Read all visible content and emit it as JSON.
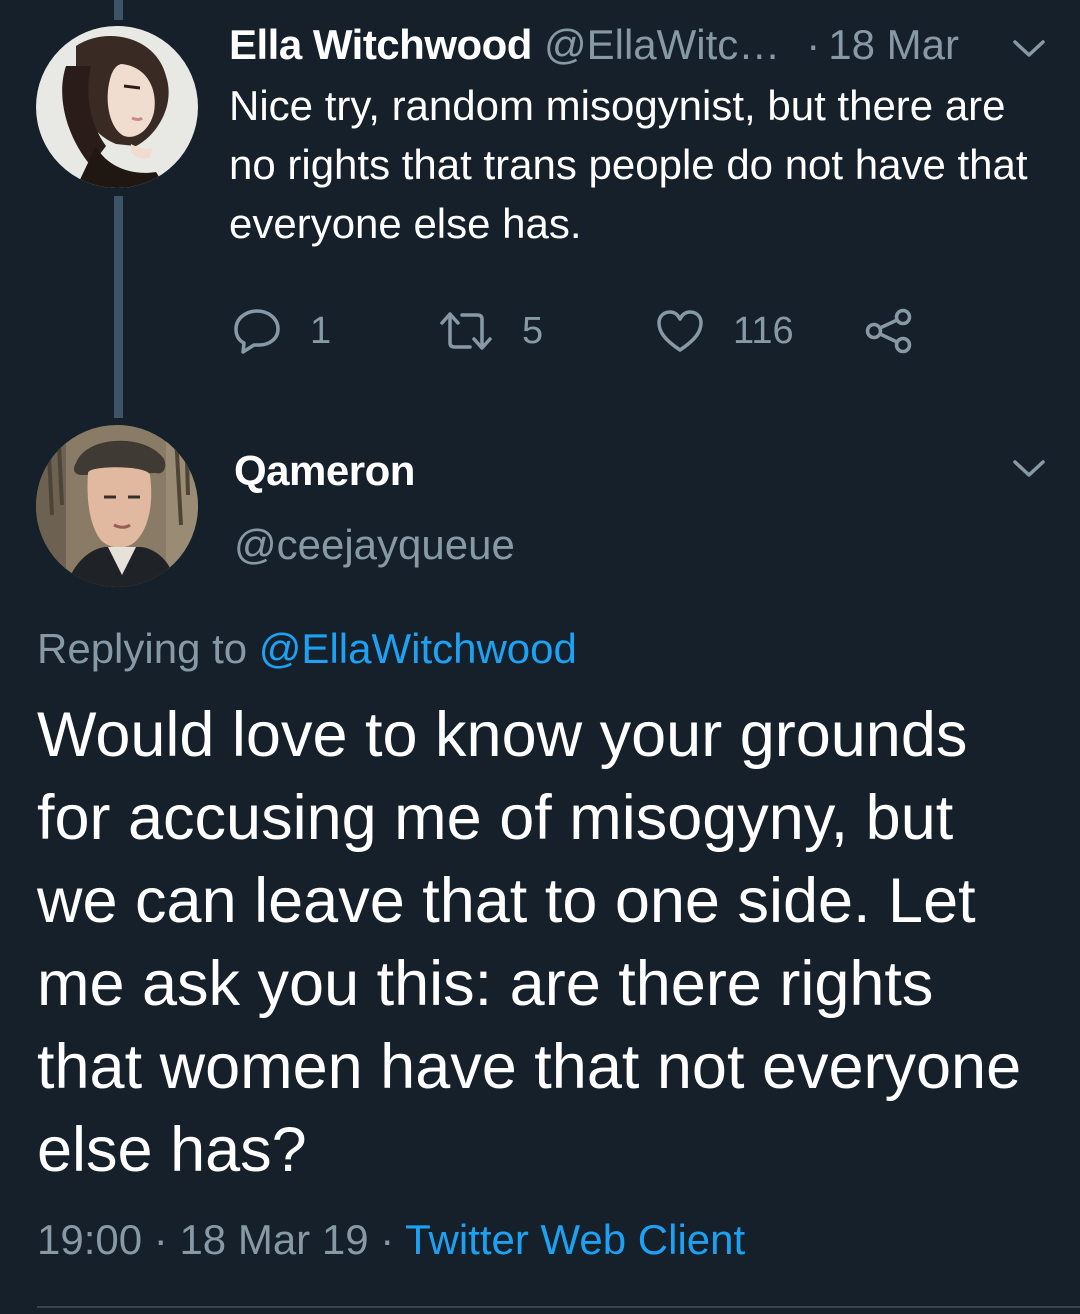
{
  "colors": {
    "background": "#15202b",
    "primary_text": "#ffffff",
    "secondary_text": "#8899a6",
    "link": "#1da1f2",
    "thread_line": "#3d5466"
  },
  "parent_tweet": {
    "author_name": "Ella Witchwood",
    "author_handle": "@EllaWitc…",
    "separator": "·",
    "date": "18 Mar",
    "text": "Nice try, random misogynist, but there are no rights that trans people do not have that everyone else has.",
    "replies_count": "1",
    "retweets_count": "5",
    "likes_count": "116",
    "icons": {
      "avatar": "woman-portrait-avatar",
      "menu": "chevron-down-icon",
      "reply": "reply-icon",
      "retweet": "retweet-icon",
      "like": "heart-icon",
      "share": "share-icon"
    }
  },
  "main_tweet": {
    "author_name": "Qameron",
    "author_handle": "@ceejayqueue",
    "replying_prefix": "Replying to ",
    "replying_handle": "@EllaWitchwood",
    "text": "Would love to know your grounds for accusing me of misogyny, but we can leave that to one side. Let me ask you this: are there rights that women have that not everyone else has?",
    "time": "19:00",
    "date": "18 Mar 19",
    "separator": "·",
    "client": "Twitter Web Client",
    "icons": {
      "avatar": "man-portrait-avatar",
      "menu": "chevron-down-icon"
    }
  }
}
